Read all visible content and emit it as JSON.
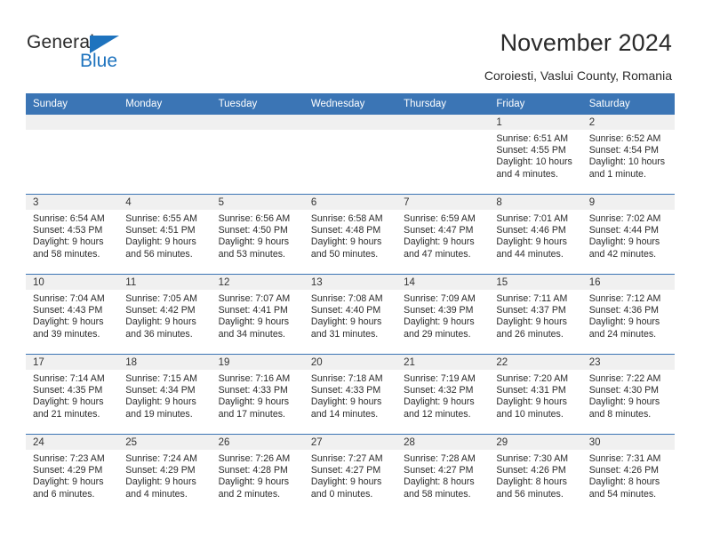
{
  "logo": {
    "primary_text": "General",
    "secondary_text": "Blue",
    "accent_color": "#1e73be",
    "triangle_icon": "triangle-icon"
  },
  "header": {
    "title": "November 2024",
    "location": "Coroiesti, Vaslui County, Romania"
  },
  "theme": {
    "header_blue": "#3b75b5",
    "daynum_band": "#f0f0f0",
    "text": "#2b2b2b"
  },
  "calendar": {
    "weekday_headers": [
      "Sunday",
      "Monday",
      "Tuesday",
      "Wednesday",
      "Thursday",
      "Friday",
      "Saturday"
    ],
    "weeks": [
      [
        {
          "day": "",
          "sunrise": "",
          "sunset": "",
          "daylight": "",
          "empty": true
        },
        {
          "day": "",
          "sunrise": "",
          "sunset": "",
          "daylight": "",
          "empty": true
        },
        {
          "day": "",
          "sunrise": "",
          "sunset": "",
          "daylight": "",
          "empty": true
        },
        {
          "day": "",
          "sunrise": "",
          "sunset": "",
          "daylight": "",
          "empty": true
        },
        {
          "day": "",
          "sunrise": "",
          "sunset": "",
          "daylight": "",
          "empty": true
        },
        {
          "day": "1",
          "sunrise": "Sunrise: 6:51 AM",
          "sunset": "Sunset: 4:55 PM",
          "daylight": "Daylight: 10 hours and 4 minutes."
        },
        {
          "day": "2",
          "sunrise": "Sunrise: 6:52 AM",
          "sunset": "Sunset: 4:54 PM",
          "daylight": "Daylight: 10 hours and 1 minute."
        }
      ],
      [
        {
          "day": "3",
          "sunrise": "Sunrise: 6:54 AM",
          "sunset": "Sunset: 4:53 PM",
          "daylight": "Daylight: 9 hours and 58 minutes."
        },
        {
          "day": "4",
          "sunrise": "Sunrise: 6:55 AM",
          "sunset": "Sunset: 4:51 PM",
          "daylight": "Daylight: 9 hours and 56 minutes."
        },
        {
          "day": "5",
          "sunrise": "Sunrise: 6:56 AM",
          "sunset": "Sunset: 4:50 PM",
          "daylight": "Daylight: 9 hours and 53 minutes."
        },
        {
          "day": "6",
          "sunrise": "Sunrise: 6:58 AM",
          "sunset": "Sunset: 4:48 PM",
          "daylight": "Daylight: 9 hours and 50 minutes."
        },
        {
          "day": "7",
          "sunrise": "Sunrise: 6:59 AM",
          "sunset": "Sunset: 4:47 PM",
          "daylight": "Daylight: 9 hours and 47 minutes."
        },
        {
          "day": "8",
          "sunrise": "Sunrise: 7:01 AM",
          "sunset": "Sunset: 4:46 PM",
          "daylight": "Daylight: 9 hours and 44 minutes."
        },
        {
          "day": "9",
          "sunrise": "Sunrise: 7:02 AM",
          "sunset": "Sunset: 4:44 PM",
          "daylight": "Daylight: 9 hours and 42 minutes."
        }
      ],
      [
        {
          "day": "10",
          "sunrise": "Sunrise: 7:04 AM",
          "sunset": "Sunset: 4:43 PM",
          "daylight": "Daylight: 9 hours and 39 minutes."
        },
        {
          "day": "11",
          "sunrise": "Sunrise: 7:05 AM",
          "sunset": "Sunset: 4:42 PM",
          "daylight": "Daylight: 9 hours and 36 minutes."
        },
        {
          "day": "12",
          "sunrise": "Sunrise: 7:07 AM",
          "sunset": "Sunset: 4:41 PM",
          "daylight": "Daylight: 9 hours and 34 minutes."
        },
        {
          "day": "13",
          "sunrise": "Sunrise: 7:08 AM",
          "sunset": "Sunset: 4:40 PM",
          "daylight": "Daylight: 9 hours and 31 minutes."
        },
        {
          "day": "14",
          "sunrise": "Sunrise: 7:09 AM",
          "sunset": "Sunset: 4:39 PM",
          "daylight": "Daylight: 9 hours and 29 minutes."
        },
        {
          "day": "15",
          "sunrise": "Sunrise: 7:11 AM",
          "sunset": "Sunset: 4:37 PM",
          "daylight": "Daylight: 9 hours and 26 minutes."
        },
        {
          "day": "16",
          "sunrise": "Sunrise: 7:12 AM",
          "sunset": "Sunset: 4:36 PM",
          "daylight": "Daylight: 9 hours and 24 minutes."
        }
      ],
      [
        {
          "day": "17",
          "sunrise": "Sunrise: 7:14 AM",
          "sunset": "Sunset: 4:35 PM",
          "daylight": "Daylight: 9 hours and 21 minutes."
        },
        {
          "day": "18",
          "sunrise": "Sunrise: 7:15 AM",
          "sunset": "Sunset: 4:34 PM",
          "daylight": "Daylight: 9 hours and 19 minutes."
        },
        {
          "day": "19",
          "sunrise": "Sunrise: 7:16 AM",
          "sunset": "Sunset: 4:33 PM",
          "daylight": "Daylight: 9 hours and 17 minutes."
        },
        {
          "day": "20",
          "sunrise": "Sunrise: 7:18 AM",
          "sunset": "Sunset: 4:33 PM",
          "daylight": "Daylight: 9 hours and 14 minutes."
        },
        {
          "day": "21",
          "sunrise": "Sunrise: 7:19 AM",
          "sunset": "Sunset: 4:32 PM",
          "daylight": "Daylight: 9 hours and 12 minutes."
        },
        {
          "day": "22",
          "sunrise": "Sunrise: 7:20 AM",
          "sunset": "Sunset: 4:31 PM",
          "daylight": "Daylight: 9 hours and 10 minutes."
        },
        {
          "day": "23",
          "sunrise": "Sunrise: 7:22 AM",
          "sunset": "Sunset: 4:30 PM",
          "daylight": "Daylight: 9 hours and 8 minutes."
        }
      ],
      [
        {
          "day": "24",
          "sunrise": "Sunrise: 7:23 AM",
          "sunset": "Sunset: 4:29 PM",
          "daylight": "Daylight: 9 hours and 6 minutes."
        },
        {
          "day": "25",
          "sunrise": "Sunrise: 7:24 AM",
          "sunset": "Sunset: 4:29 PM",
          "daylight": "Daylight: 9 hours and 4 minutes."
        },
        {
          "day": "26",
          "sunrise": "Sunrise: 7:26 AM",
          "sunset": "Sunset: 4:28 PM",
          "daylight": "Daylight: 9 hours and 2 minutes."
        },
        {
          "day": "27",
          "sunrise": "Sunrise: 7:27 AM",
          "sunset": "Sunset: 4:27 PM",
          "daylight": "Daylight: 9 hours and 0 minutes."
        },
        {
          "day": "28",
          "sunrise": "Sunrise: 7:28 AM",
          "sunset": "Sunset: 4:27 PM",
          "daylight": "Daylight: 8 hours and 58 minutes."
        },
        {
          "day": "29",
          "sunrise": "Sunrise: 7:30 AM",
          "sunset": "Sunset: 4:26 PM",
          "daylight": "Daylight: 8 hours and 56 minutes."
        },
        {
          "day": "30",
          "sunrise": "Sunrise: 7:31 AM",
          "sunset": "Sunset: 4:26 PM",
          "daylight": "Daylight: 8 hours and 54 minutes."
        }
      ]
    ]
  }
}
